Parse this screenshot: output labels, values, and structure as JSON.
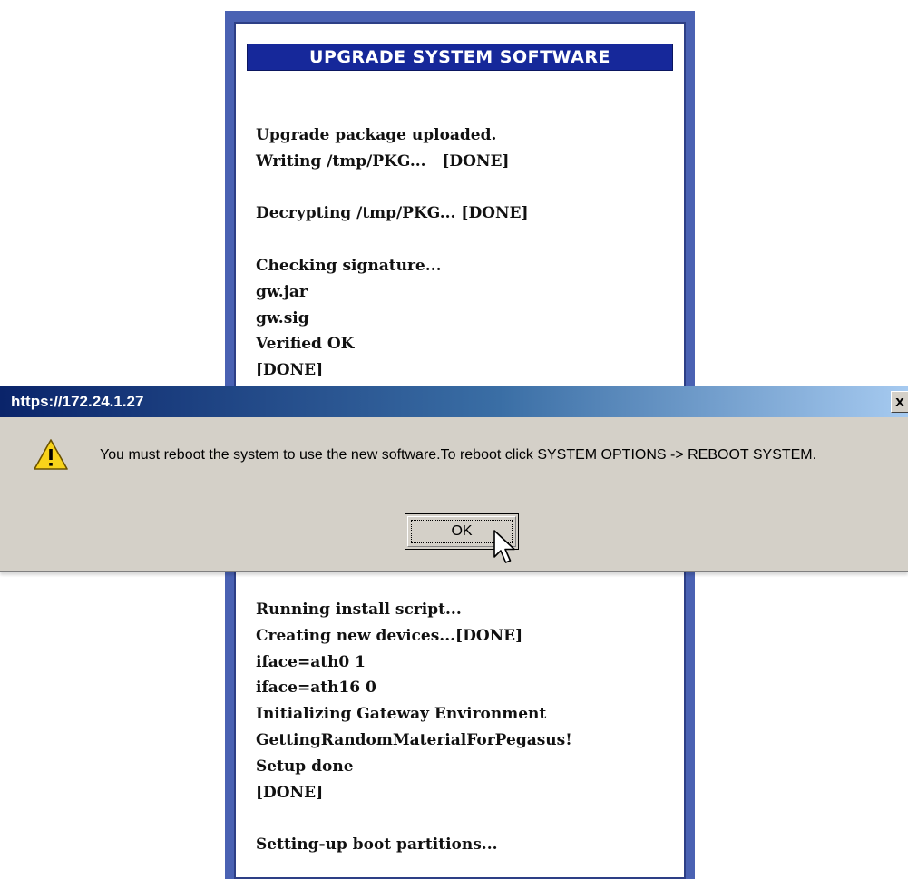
{
  "panel": {
    "title": "UPGRADE SYSTEM SOFTWARE",
    "log_top": [
      "Upgrade package uploaded.",
      "Writing /tmp/PKG...   [DONE]",
      "",
      "Decrypting /tmp/PKG... [DONE]",
      "",
      "Checking signature...",
      "gw.jar",
      "gw.sig",
      "Verified OK",
      "[DONE]"
    ],
    "log_bottom": [
      "Running install script...",
      "Creating new devices...[DONE]",
      "iface=ath0 1",
      "iface=ath16 0",
      "Initializing Gateway Environment",
      "GettingRandomMaterialForPegasus!",
      "Setup done",
      "[DONE]",
      "",
      "Setting-up boot partitions..."
    ]
  },
  "dialog": {
    "title": "https://172.24.1.27",
    "close_label": "x",
    "message": "You must reboot the system to use the new software.To reboot click SYSTEM OPTIONS -> REBOOT SYSTEM.",
    "ok_label": "OK",
    "icon": "warning-icon"
  },
  "colors": {
    "panel_border": "#4a62b3",
    "panel_title_bg": "#16289a",
    "dialog_bg": "#d4d0c8",
    "titlebar_start": "#0a246a",
    "titlebar_end": "#a6caf0",
    "warning_yellow": "#f8d31a"
  }
}
